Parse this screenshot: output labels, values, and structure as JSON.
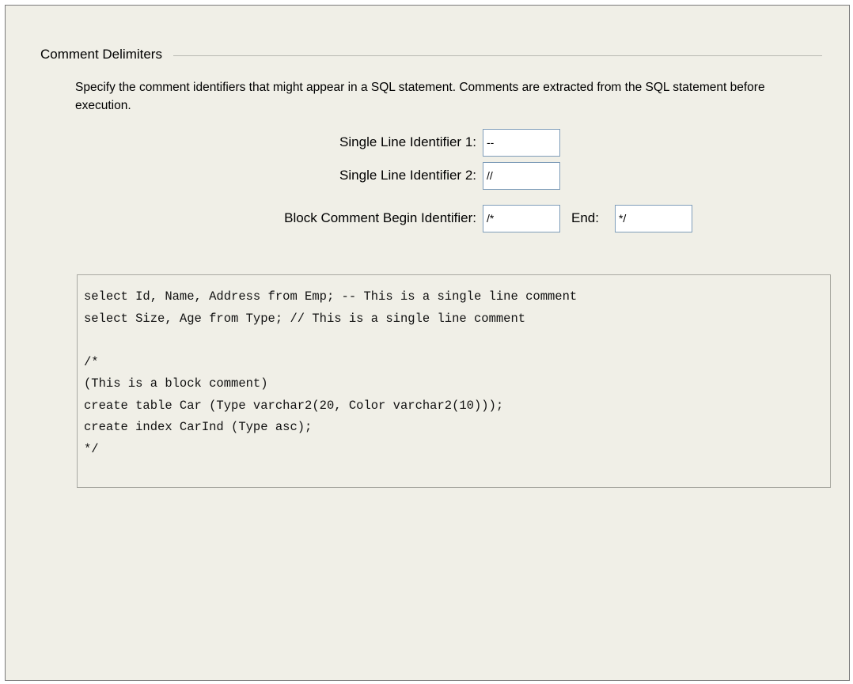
{
  "section": {
    "title": "Comment Delimiters",
    "description": "Specify the comment identifiers that might appear in a SQL statement. Comments are extracted from the SQL statement before execution."
  },
  "fields": {
    "single_line_1": {
      "label": "Single Line Identifier 1:",
      "value": "--"
    },
    "single_line_2": {
      "label": "Single Line Identifier 2:",
      "value": "//"
    },
    "block_begin": {
      "label": "Block Comment Begin Identifier:",
      "value": "/*"
    },
    "block_end": {
      "label": "End:",
      "value": "*/"
    }
  },
  "example": {
    "lines": [
      "select Id, Name, Address from Emp; -- This is a single line comment",
      "select Size, Age from Type; // This is a single line comment",
      "",
      "/*",
      "(This is a block comment)",
      "create table Car (Type varchar2(20, Color varchar2(10)));",
      "create index CarInd (Type asc);",
      "*/"
    ]
  }
}
